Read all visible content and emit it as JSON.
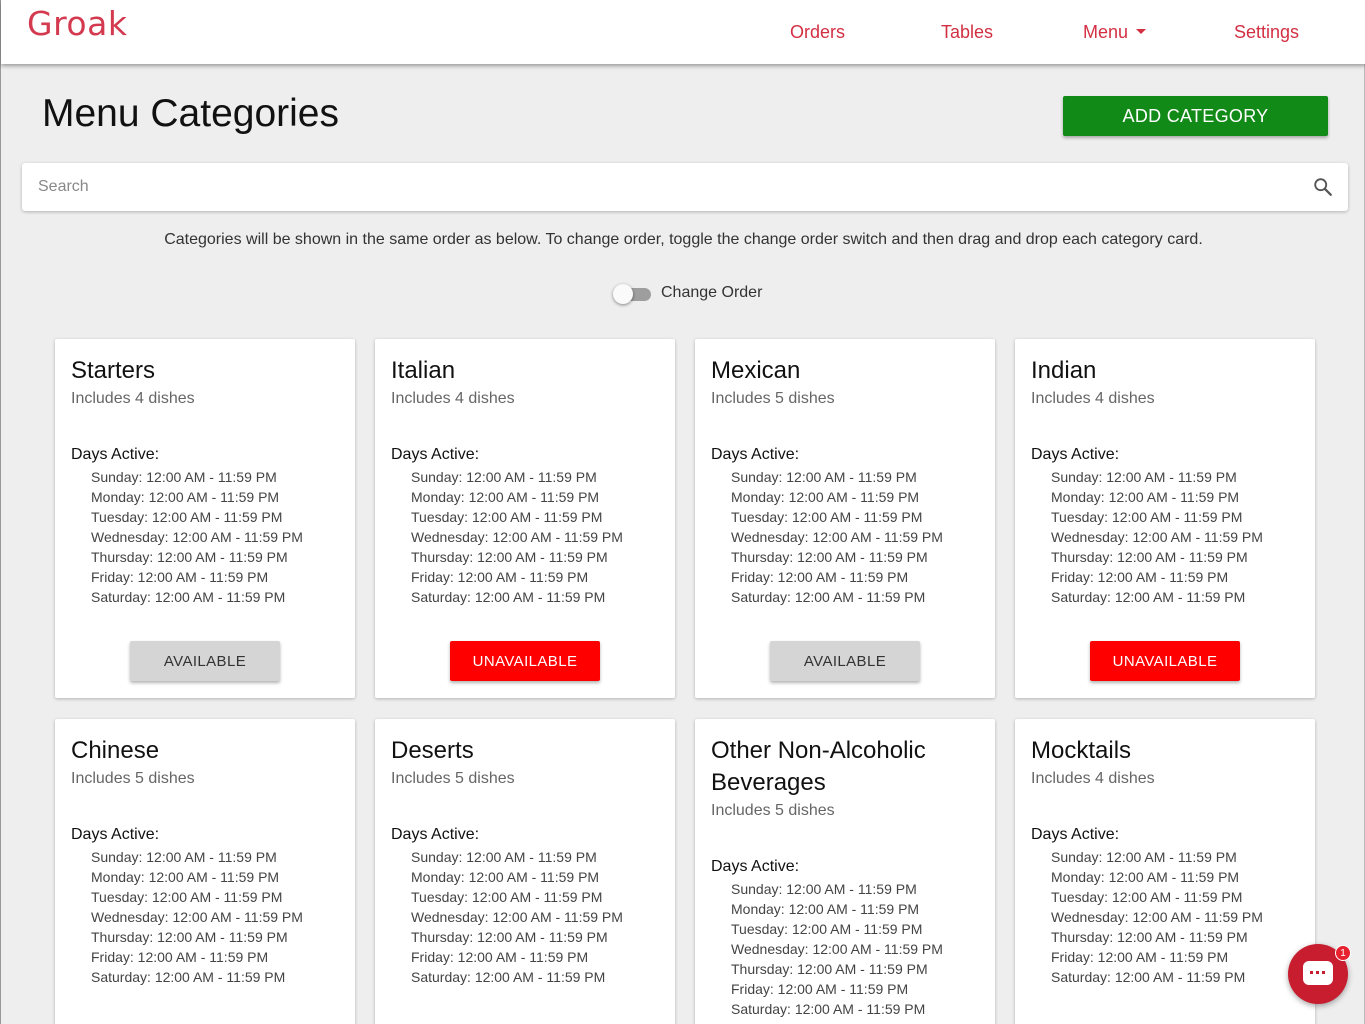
{
  "header": {
    "logo": "Groak",
    "nav": {
      "orders": "Orders",
      "tables": "Tables",
      "menu": "Menu",
      "settings": "Settings"
    }
  },
  "page": {
    "title": "Menu Categories",
    "add_button": "ADD CATEGORY",
    "search_placeholder": "Search",
    "info": "Categories will be shown in the same order as below. To change order, toggle the change order switch and then drag and drop each category card.",
    "toggle_label": "Change Order",
    "toggle_on": false
  },
  "colors": {
    "brand": "#d32f43",
    "add_button": "#128a17",
    "unavailable": "#ff0000",
    "available": "#d5d5d5"
  },
  "cards": [
    {
      "title": "Starters",
      "subtitle": "Includes 4 dishes",
      "days_label": "Days Active:",
      "days": [
        "Sunday: 12:00 AM - 11:59 PM",
        "Monday: 12:00 AM - 11:59 PM",
        "Tuesday: 12:00 AM - 11:59 PM",
        "Wednesday: 12:00 AM - 11:59 PM",
        "Thursday: 12:00 AM - 11:59 PM",
        "Friday: 12:00 AM - 11:59 PM",
        "Saturday: 12:00 AM - 11:59 PM"
      ],
      "status": "AVAILABLE"
    },
    {
      "title": "Italian",
      "subtitle": "Includes 4 dishes",
      "days_label": "Days Active:",
      "days": [
        "Sunday: 12:00 AM - 11:59 PM",
        "Monday: 12:00 AM - 11:59 PM",
        "Tuesday: 12:00 AM - 11:59 PM",
        "Wednesday: 12:00 AM - 11:59 PM",
        "Thursday: 12:00 AM - 11:59 PM",
        "Friday: 12:00 AM - 11:59 PM",
        "Saturday: 12:00 AM - 11:59 PM"
      ],
      "status": "UNAVAILABLE"
    },
    {
      "title": "Mexican",
      "subtitle": "Includes 5 dishes",
      "days_label": "Days Active:",
      "days": [
        "Sunday: 12:00 AM - 11:59 PM",
        "Monday: 12:00 AM - 11:59 PM",
        "Tuesday: 12:00 AM - 11:59 PM",
        "Wednesday: 12:00 AM - 11:59 PM",
        "Thursday: 12:00 AM - 11:59 PM",
        "Friday: 12:00 AM - 11:59 PM",
        "Saturday: 12:00 AM - 11:59 PM"
      ],
      "status": "AVAILABLE"
    },
    {
      "title": "Indian",
      "subtitle": "Includes 4 dishes",
      "days_label": "Days Active:",
      "days": [
        "Sunday: 12:00 AM - 11:59 PM",
        "Monday: 12:00 AM - 11:59 PM",
        "Tuesday: 12:00 AM - 11:59 PM",
        "Wednesday: 12:00 AM - 11:59 PM",
        "Thursday: 12:00 AM - 11:59 PM",
        "Friday: 12:00 AM - 11:59 PM",
        "Saturday: 12:00 AM - 11:59 PM"
      ],
      "status": "UNAVAILABLE"
    },
    {
      "title": "Chinese",
      "subtitle": "Includes 5 dishes",
      "days_label": "Days Active:",
      "days": [
        "Sunday: 12:00 AM - 11:59 PM",
        "Monday: 12:00 AM - 11:59 PM",
        "Tuesday: 12:00 AM - 11:59 PM",
        "Wednesday: 12:00 AM - 11:59 PM",
        "Thursday: 12:00 AM - 11:59 PM",
        "Friday: 12:00 AM - 11:59 PM",
        "Saturday: 12:00 AM - 11:59 PM"
      ]
    },
    {
      "title": "Deserts",
      "subtitle": "Includes 5 dishes",
      "days_label": "Days Active:",
      "days": [
        "Sunday: 12:00 AM - 11:59 PM",
        "Monday: 12:00 AM - 11:59 PM",
        "Tuesday: 12:00 AM - 11:59 PM",
        "Wednesday: 12:00 AM - 11:59 PM",
        "Thursday: 12:00 AM - 11:59 PM",
        "Friday: 12:00 AM - 11:59 PM",
        "Saturday: 12:00 AM - 11:59 PM"
      ]
    },
    {
      "title": "Other Non-Alcoholic Beverages",
      "subtitle": "Includes 5 dishes",
      "days_label": "Days Active:",
      "days": [
        "Sunday: 12:00 AM - 11:59 PM",
        "Monday: 12:00 AM - 11:59 PM",
        "Tuesday: 12:00 AM - 11:59 PM",
        "Wednesday: 12:00 AM - 11:59 PM",
        "Thursday: 12:00 AM - 11:59 PM",
        "Friday: 12:00 AM - 11:59 PM",
        "Saturday: 12:00 AM - 11:59 PM"
      ]
    },
    {
      "title": "Mocktails",
      "subtitle": "Includes 4 dishes",
      "days_label": "Days Active:",
      "days": [
        "Sunday: 12:00 AM - 11:59 PM",
        "Monday: 12:00 AM - 11:59 PM",
        "Tuesday: 12:00 AM - 11:59 PM",
        "Wednesday: 12:00 AM - 11:59 PM",
        "Thursday: 12:00 AM - 11:59 PM",
        "Friday: 12:00 AM - 11:59 PM",
        "Saturday: 12:00 AM - 11:59 PM"
      ]
    }
  ],
  "chat": {
    "icon": "chat-icon",
    "badge": "1"
  }
}
